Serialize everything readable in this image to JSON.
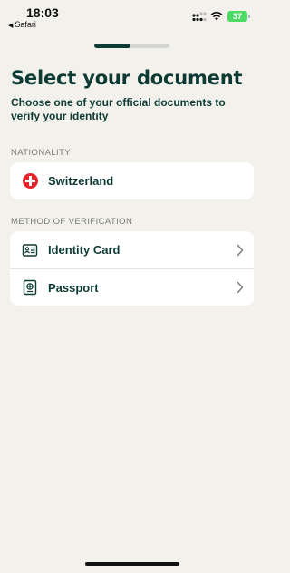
{
  "status_bar": {
    "time": "18:03",
    "back_app": "Safari",
    "battery": "37"
  },
  "progress": {
    "value": 0.48
  },
  "header": {
    "title": "Select your document",
    "subtitle": "Choose one of your official documents to verify your identity"
  },
  "nationality": {
    "section_label": "NATIONALITY",
    "country": "Switzerland",
    "flag_icon": "switzerland-flag-icon"
  },
  "verification": {
    "section_label": "METHOD OF VERIFICATION",
    "options": [
      {
        "label": "Identity Card",
        "icon": "id-card-icon"
      },
      {
        "label": "Passport",
        "icon": "passport-icon"
      }
    ]
  },
  "colors": {
    "background": "#f3f1ec",
    "primary_text": "#0e3a34",
    "section_label": "#7a7a76",
    "flag_red": "#e8242a",
    "battery": "#4cd964"
  }
}
